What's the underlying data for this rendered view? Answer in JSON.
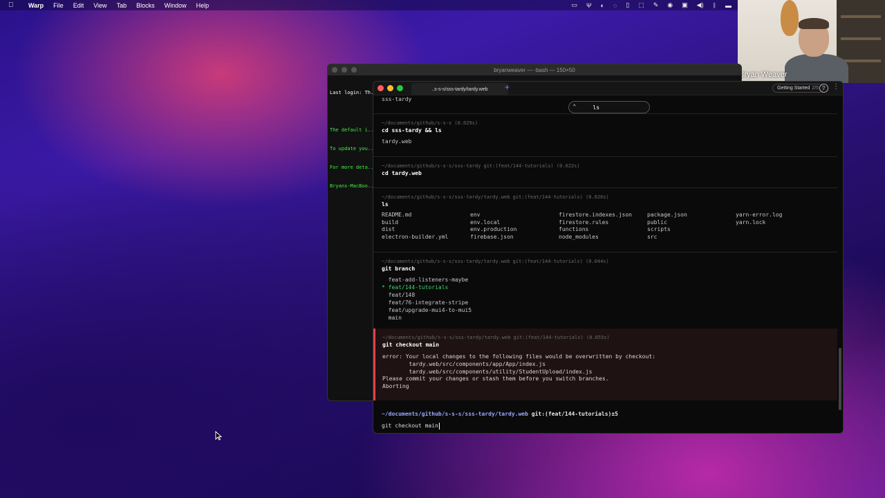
{
  "menubar": {
    "app_name": "Warp",
    "items": [
      "File",
      "Edit",
      "View",
      "Tab",
      "Blocks",
      "Window",
      "Help"
    ]
  },
  "webcam": {
    "name": "Bryan Weaver"
  },
  "bash_window": {
    "title": "bryanweaver — -bash — 150×50",
    "lines": [
      "Last login: Th...",
      "",
      "The default i...",
      "To update you...",
      "For more deta...",
      "Bryans-MacBoo..."
    ]
  },
  "warp": {
    "tab_title": "..s-s-s/sss-tardy/tardy.web",
    "new_tab": "+",
    "getting_started": {
      "label": "Getting Started",
      "progress": "2/5"
    },
    "search_value": "ls",
    "top_output": "sss-tardy",
    "blocks": [
      {
        "meta": "~/documents/github/s-s-s (0.029s)",
        "cmd": "cd sss-tardy && ls",
        "out": "tardy.web"
      },
      {
        "meta": "~/documents/github/s-s-s/sss-tardy git:(feat/144-tutorials) (0.022s)",
        "cmd": "cd tardy.web"
      },
      {
        "meta": "~/documents/github/s-s-s/sss-tardy/tardy.web git:(feat/144-tutorials) (0.026s)",
        "cmd": "ls"
      },
      {
        "meta": "~/documents/github/s-s-s/sss-tardy/tardy.web git:(feat/144-tutorials) (0.044s)",
        "cmd": "git branch"
      }
    ],
    "ls_files": [
      "README.md",
      "env",
      "firestore.indexes.json",
      "package.json",
      "yarn-error.log",
      "build",
      "env.local",
      "firestore.rules",
      "public",
      "yarn.lock",
      "dist",
      "env.production",
      "functions",
      "scripts",
      "",
      "electron-builder.yml",
      "firebase.json",
      "node_modules",
      "src",
      ""
    ],
    "branches": [
      {
        "name": "  feat-add-listeners-maybe",
        "current": false
      },
      {
        "name": "* feat/144-tutorials",
        "current": true
      },
      {
        "name": "  feat/148",
        "current": false
      },
      {
        "name": "  feat/76-integrate-stripe",
        "current": false
      },
      {
        "name": "  feat/upgrade-mui4-to-mui5",
        "current": false
      },
      {
        "name": "  main",
        "current": false
      }
    ],
    "error_block": {
      "meta": "~/documents/github/s-s-s/sss-tardy/tardy.web git:(feat/144-tutorials) (0.055s)",
      "cmd": "git checkout main",
      "out": "error: Your local changes to the following files would be overwritten by checkout:\n        tardy.web/src/components/app/App/index.js\n        tardy.web/src/components/utility/StudentUpload/index.js\nPlease commit your changes or stash them before you switch branches.\nAborting"
    },
    "prompt": {
      "path": "~/documents/github/s-s-s/sss-tardy/tardy.web",
      "git": "git:(",
      "branch": "feat/144-tutorials",
      "suffix": ")±5"
    },
    "input_value": "git checkout main"
  },
  "colors": {
    "accent": "#6a8cff",
    "error": "#e8404a",
    "branch_current": "#3ed66b"
  }
}
